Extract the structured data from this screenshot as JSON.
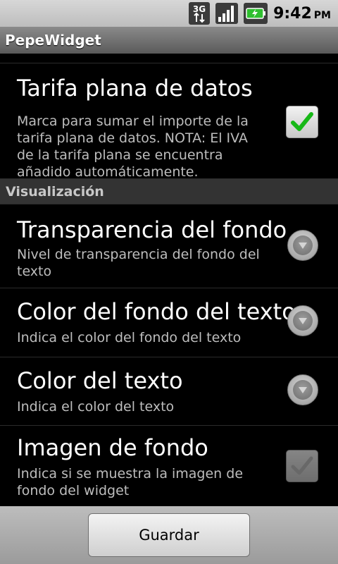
{
  "status_bar": {
    "network_type": "3G",
    "time": "9:42",
    "ampm": "PM",
    "icons": [
      "3g-data-icon",
      "signal-strength-icon",
      "battery-charging-icon"
    ],
    "accent": "#2fbf2f"
  },
  "app": {
    "title": "PepeWidget"
  },
  "preferences": {
    "data_plan": {
      "title": "Tarifa plana de datos",
      "summary": "Marca para sumar el importe de la tarifa plana de datos. NOTA: El IVA de la tarifa plana se encuentra añadido automáticamente.",
      "checked": true
    },
    "category": "Visualización",
    "transparency": {
      "title": "Transparencia del fondo",
      "summary": "Nivel de transparencia del fondo del texto"
    },
    "bg_color": {
      "title": "Color del fondo del texto",
      "summary": "Indica el color del fondo del texto"
    },
    "text_color": {
      "title": "Color del texto",
      "summary": "Indica el color del texto"
    },
    "bg_image": {
      "title": "Imagen de fondo",
      "summary": "Indica si se muestra la imagen de fondo del widget",
      "checked": true,
      "enabled": false
    }
  },
  "footer": {
    "save_label": "Guardar"
  }
}
